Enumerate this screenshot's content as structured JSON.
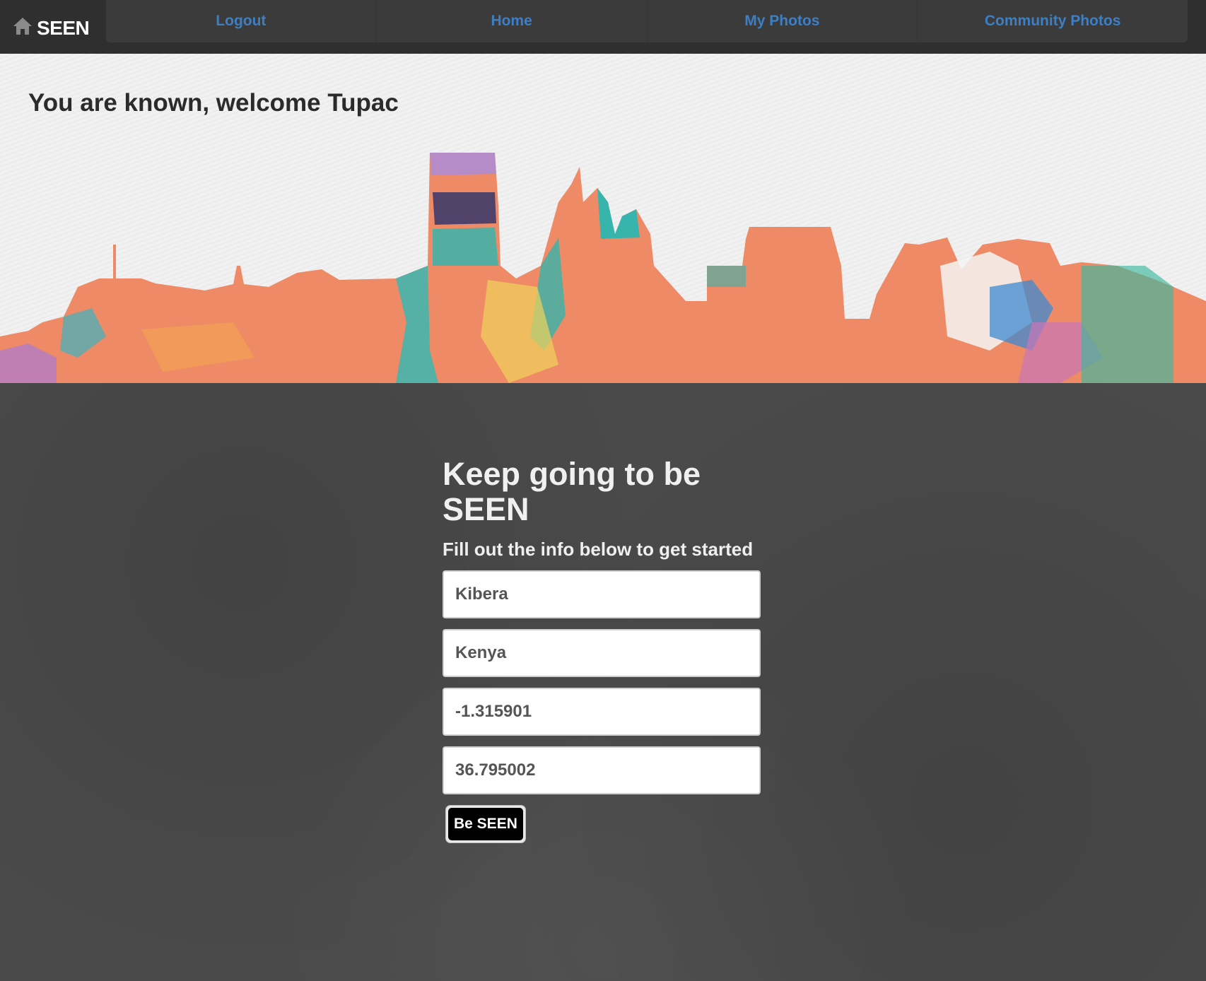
{
  "navbar": {
    "brand": "SEEN",
    "brand_icon": "home-icon",
    "links": [
      {
        "label": "Logout"
      },
      {
        "label": "Home"
      },
      {
        "label": "My Photos"
      },
      {
        "label": "Community Photos"
      }
    ],
    "link_color": "#3c7fc4",
    "background": "#2f2f2f"
  },
  "hero": {
    "welcome": "You are known, welcome Tupac",
    "image": "watercolor-city-skyline"
  },
  "form": {
    "title": "Keep going to be SEEN",
    "subtitle": "Fill out the info below to get started",
    "fields": [
      {
        "value": "Kibera"
      },
      {
        "value": "Kenya"
      },
      {
        "value": "-1.315901"
      },
      {
        "value": "36.795002"
      }
    ],
    "submit_label": "Be SEEN"
  }
}
